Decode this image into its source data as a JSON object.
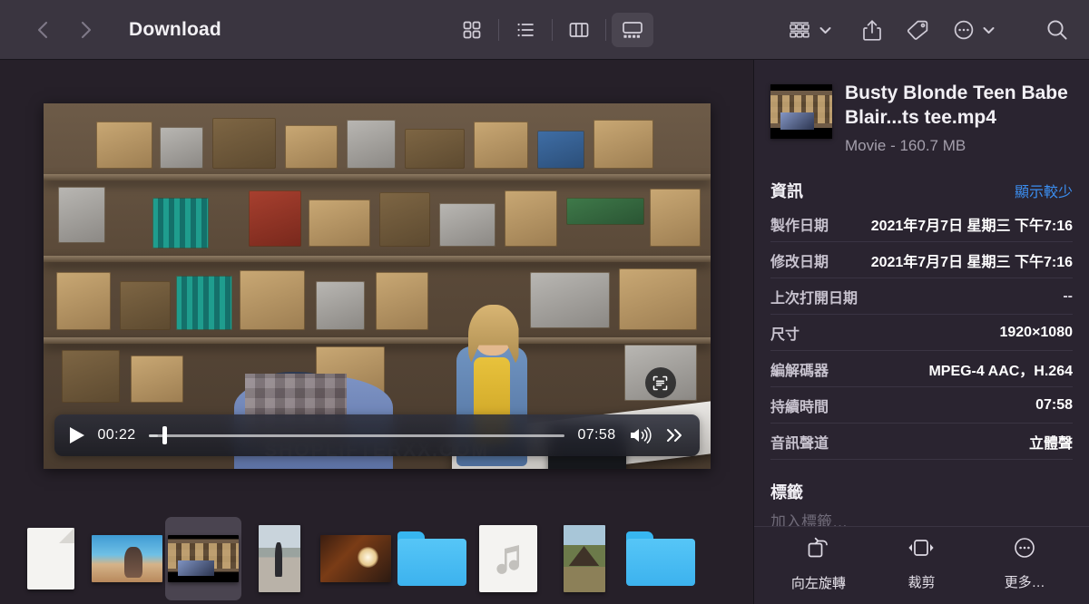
{
  "window": {
    "title": "Download",
    "back_icon": "chevron-left-icon",
    "forward_icon": "chevron-right-icon"
  },
  "toolbar": {
    "view_modes": [
      {
        "name": "icon-view",
        "icon": "grid-icon",
        "active": false
      },
      {
        "name": "list-view",
        "icon": "list-icon",
        "active": false
      },
      {
        "name": "column-view",
        "icon": "columns-icon",
        "active": false
      },
      {
        "name": "gallery-view",
        "icon": "gallery-icon",
        "active": true
      }
    ],
    "group_icon": "group-by-icon",
    "group_caret": "chevron-down-icon",
    "share_icon": "share-icon",
    "tag_icon": "tag-icon",
    "more_icon": "ellipsis-circle-icon",
    "more_caret": "chevron-down-icon",
    "search_icon": "search-icon"
  },
  "preview": {
    "watermark": "SHOPLIFTERXX.COM",
    "live_text_icon": "live-text-icon",
    "player": {
      "play_icon": "play-icon",
      "current_time": "00:22",
      "total_time": "07:58",
      "progress_percent": 3.4,
      "volume_icon": "speaker-waves-icon",
      "forward_icon": "double-chevron-right-icon"
    }
  },
  "filmstrip": {
    "items": [
      {
        "name": "filmstrip-item-document",
        "kind": "document",
        "selected": false
      },
      {
        "name": "filmstrip-item-photo-beach",
        "kind": "image-beach",
        "selected": false
      },
      {
        "name": "filmstrip-item-video-store",
        "kind": "image-store",
        "selected": true
      },
      {
        "name": "filmstrip-item-photo-street",
        "kind": "image-street",
        "selected": false
      },
      {
        "name": "filmstrip-item-photo-lamp",
        "kind": "image-lamp",
        "selected": false
      },
      {
        "name": "filmstrip-item-folder-1",
        "kind": "folder",
        "selected": false
      },
      {
        "name": "filmstrip-item-audio",
        "kind": "audio",
        "selected": false
      },
      {
        "name": "filmstrip-item-photo-temple",
        "kind": "image-temple",
        "selected": false
      },
      {
        "name": "filmstrip-item-folder-2",
        "kind": "folder",
        "selected": false
      }
    ]
  },
  "sidebar": {
    "file": {
      "name": "Busty Blonde Teen Babe Blair...ts tee.mp4",
      "subtitle": "Movie - 160.7 MB"
    },
    "info": {
      "heading": "資訊",
      "toggle_link": "顯示較少",
      "rows": [
        {
          "label": "製作日期",
          "value": "2021年7月7日 星期三 下午7:16"
        },
        {
          "label": "修改日期",
          "value": "2021年7月7日 星期三 下午7:16"
        },
        {
          "label": "上次打開日期",
          "value": "--"
        },
        {
          "label": "尺寸",
          "value": "1920×1080"
        },
        {
          "label": "編解碼器",
          "value": "MPEG-4 AAC，H.264"
        },
        {
          "label": "持續時間",
          "value": "07:58"
        },
        {
          "label": "音訊聲道",
          "value": "立體聲"
        }
      ]
    },
    "tags": {
      "heading": "標籤",
      "placeholder": "加入標籤…"
    },
    "actions": [
      {
        "label": "向左旋轉",
        "icon": "rotate-left-icon"
      },
      {
        "label": "裁剪",
        "icon": "trim-icon"
      },
      {
        "label": "更多…",
        "icon": "ellipsis-circle-icon"
      }
    ]
  },
  "colors": {
    "toolbar_bg": "#3a3540",
    "content_bg": "#262029",
    "sidebar_bg": "#2a2430",
    "accent_link": "#3b8ef0",
    "folder_blue": "#48bdf3"
  }
}
